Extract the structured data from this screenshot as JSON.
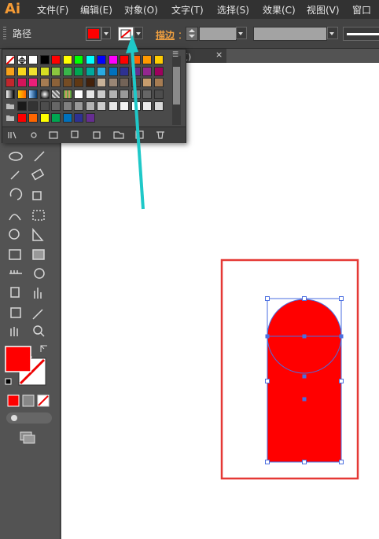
{
  "app": {
    "logo": "Ai"
  },
  "menu": [
    "文件(F)",
    "编辑(E)",
    "对象(O)",
    "文字(T)",
    "选择(S)",
    "效果(C)",
    "视图(V)",
    "窗口"
  ],
  "control_bar": {
    "selection_type": "路径",
    "stroke_label": "描边",
    "stroke_colon": "："
  },
  "document_tab": {
    "label": "览)",
    "close": "×"
  },
  "colors": {
    "fill": "#ff0000",
    "accent_arrow": "#1fc8c8",
    "selection_frame": "#4a6ee0",
    "highlight_box": "#e53935"
  },
  "swatches": {
    "rows": [
      [
        "none",
        "registration",
        "#ffffff",
        "#000000",
        "#ff0000",
        "#ffff00",
        "#00ff00",
        "#00ffff",
        "#0000ff",
        "#ff00ff",
        "#ff0000",
        "#ff6600",
        "#ff9900",
        "#ffcc00"
      ],
      [
        "#f7a11a",
        "#f9d71c",
        "#f0e130",
        "#d6df22",
        "#8cc63f",
        "#39b54a",
        "#00a651",
        "#00a99d",
        "#29abe2",
        "#0071bc",
        "#2e3192",
        "#662d91",
        "#93278f",
        "#9e005d"
      ],
      [
        "#c1272d",
        "#d4145a",
        "#ed1e79",
        "#a67c52",
        "#8c6239",
        "#754c24",
        "#603813",
        "#42210b",
        "#c7b299",
        "#998675",
        "#736357",
        "#534741",
        "#c69c6d",
        "#a67c52"
      ],
      [
        "gradient-bw",
        "gradient-orange",
        "gradient-blue",
        "gradient-radial",
        "pattern-dots",
        "pattern-leaves",
        "#ffffff",
        "#e6e6e6",
        "#cccccc",
        "#b3b3b3",
        "#999999",
        "#808080",
        "#666666",
        "#4d4d4d"
      ],
      [
        "folder",
        "#1a1a1a",
        "#333333",
        "#4d4d4d",
        "#666666",
        "#808080",
        "#999999",
        "#b3b3b3",
        "#cccccc",
        "#e6e6e6",
        "#f2f2f2",
        "#ffffff",
        "#ebebeb",
        "#d9d9d9"
      ],
      [
        "folder",
        "#ff0000",
        "#ff6600",
        "#ffff00",
        "#00a651",
        "#0071bc",
        "#2e3192",
        "#662d91"
      ]
    ]
  },
  "icons": {
    "libraries": "libraries-icon",
    "show_kinds": "show-kinds-icon",
    "swatch_options": "swatch-options-icon",
    "new_group": "new-color-group-icon",
    "new_swatch": "new-swatch-icon",
    "delete": "delete-swatch-icon"
  }
}
